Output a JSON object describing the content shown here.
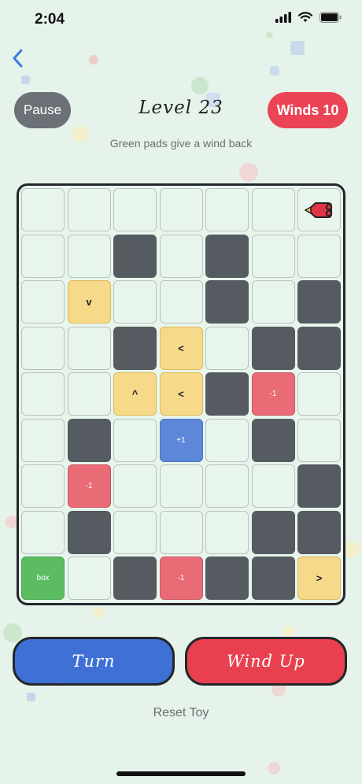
{
  "status_bar": {
    "time": "2:04"
  },
  "header": {
    "pause_label": "Pause",
    "level_title": "Level 23",
    "winds_label": "Winds 10",
    "hint": "Green pads give a wind back"
  },
  "board": {
    "cols": 7,
    "rows": 9,
    "cells": [
      [
        "empty",
        "empty",
        "empty",
        "empty",
        "empty",
        "empty",
        "toy"
      ],
      [
        "empty",
        "empty",
        "wall",
        "empty",
        "wall",
        "empty",
        "empty"
      ],
      [
        "empty",
        "arrow:v",
        "empty",
        "empty",
        "wall",
        "empty",
        "wall"
      ],
      [
        "empty",
        "empty",
        "wall",
        "arrow:<",
        "empty",
        "wall",
        "wall"
      ],
      [
        "empty",
        "empty",
        "arrow:^",
        "arrow:<",
        "wall",
        "minus:-1",
        "empty"
      ],
      [
        "empty",
        "wall",
        "empty",
        "plus:+1",
        "empty",
        "wall",
        "empty"
      ],
      [
        "empty",
        "minus:-1",
        "empty",
        "empty",
        "empty",
        "empty",
        "wall"
      ],
      [
        "empty",
        "wall",
        "empty",
        "empty",
        "empty",
        "wall",
        "wall"
      ],
      [
        "goal:box",
        "empty",
        "wall",
        "minus:-1",
        "wall",
        "wall",
        "arrow:>"
      ]
    ]
  },
  "controls": {
    "turn_label": "Turn",
    "wind_up_label": "Wind Up",
    "reset_label": "Reset Toy"
  },
  "colors": {
    "background": "#e6f3ea",
    "wall": "#555b60",
    "arrow_pad": "#f7d98a",
    "minus_pad": "#e86b75",
    "plus_pad": "#5d87d8",
    "goal_pad": "#5cbc62",
    "turn_button": "#3f70d6",
    "wind_button": "#e8404e",
    "toy": "#e03444"
  }
}
